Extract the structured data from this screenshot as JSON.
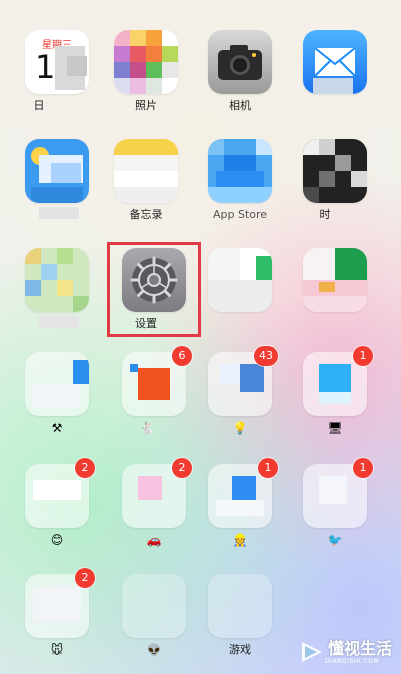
{
  "home_screen": {
    "row1": {
      "calendar": {
        "weekday": "星期三",
        "day": "1",
        "label": "日"
      },
      "photos": {
        "label": "照片"
      },
      "camera": {
        "label": "相机"
      },
      "mail": {
        "label": ""
      }
    },
    "row2": {
      "weather": {
        "label": ""
      },
      "notes": {
        "label": "备忘录"
      },
      "app_store": {
        "label": "App Store"
      },
      "clock": {
        "label": "时"
      }
    },
    "row3": {
      "maps": {
        "label": ""
      },
      "settings": {
        "label": "设置"
      },
      "facetime": {
        "label": ""
      },
      "reminders": {
        "label": ""
      }
    },
    "row4": {
      "app_a": {
        "label": "⚒",
        "badge": ""
      },
      "app_b": {
        "label": "🐇",
        "badge": "6"
      },
      "app_c": {
        "label": "💡",
        "badge": "43"
      },
      "app_d": {
        "label": "🖥",
        "badge": "1"
      }
    },
    "row5": {
      "app_e": {
        "label": "😊",
        "badge": "2"
      },
      "app_f": {
        "label": "🚗",
        "badge": "2"
      },
      "app_g": {
        "label": "👷",
        "badge": "1"
      },
      "app_h": {
        "label": "🐦",
        "badge": "1"
      }
    },
    "row6": {
      "app_i": {
        "label": "🐭",
        "badge": "2"
      },
      "app_j": {
        "label": "👽",
        "badge": ""
      },
      "games": {
        "label": "游戏",
        "badge": ""
      }
    }
  },
  "watermark": {
    "title": "懂视生活",
    "subtitle": "DIANQISHI.COM"
  },
  "colors": {
    "highlight": "#e23a45",
    "badge": "#f23b30",
    "mail_blue": "#1a8cff",
    "camera_gray": "#6b6b6b"
  }
}
